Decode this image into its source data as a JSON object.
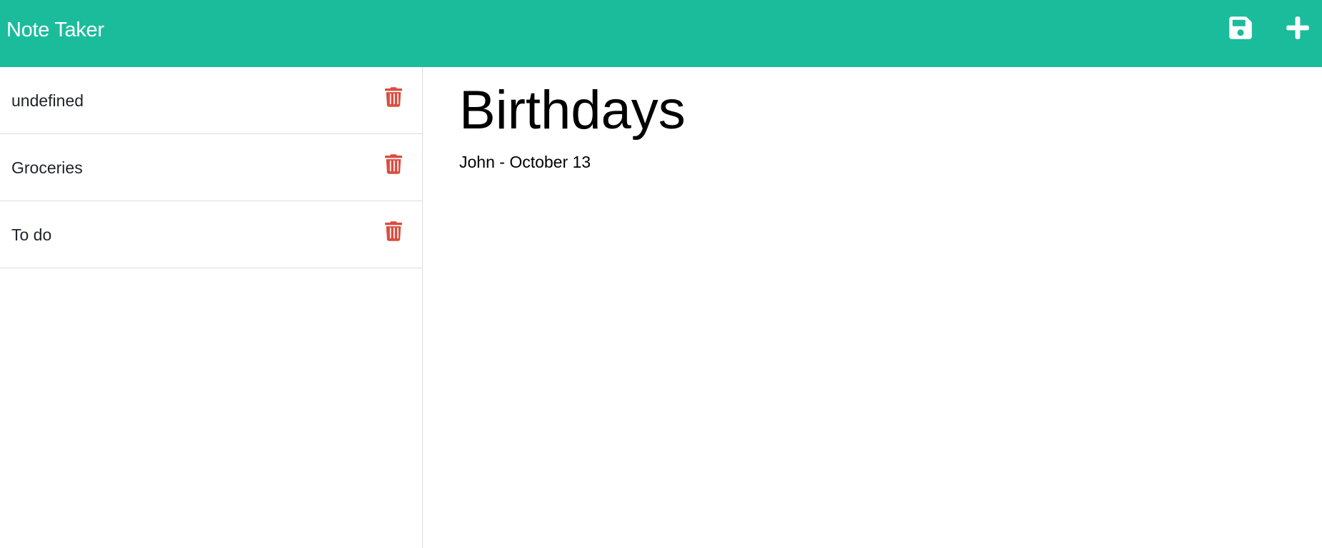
{
  "app": {
    "title": "Note Taker",
    "accent_color": "#1abc9c",
    "delete_color": "#dc4c3f"
  },
  "toolbar": {
    "save_icon": "floppy-disk-icon",
    "new_icon": "plus-icon"
  },
  "notes": [
    {
      "title": "undefined",
      "icon": "trash-icon"
    },
    {
      "title": "Groceries",
      "icon": "trash-icon"
    },
    {
      "title": "To do",
      "icon": "trash-icon"
    }
  ],
  "active_note": {
    "title": "Birthdays",
    "text": "John - October 13"
  }
}
